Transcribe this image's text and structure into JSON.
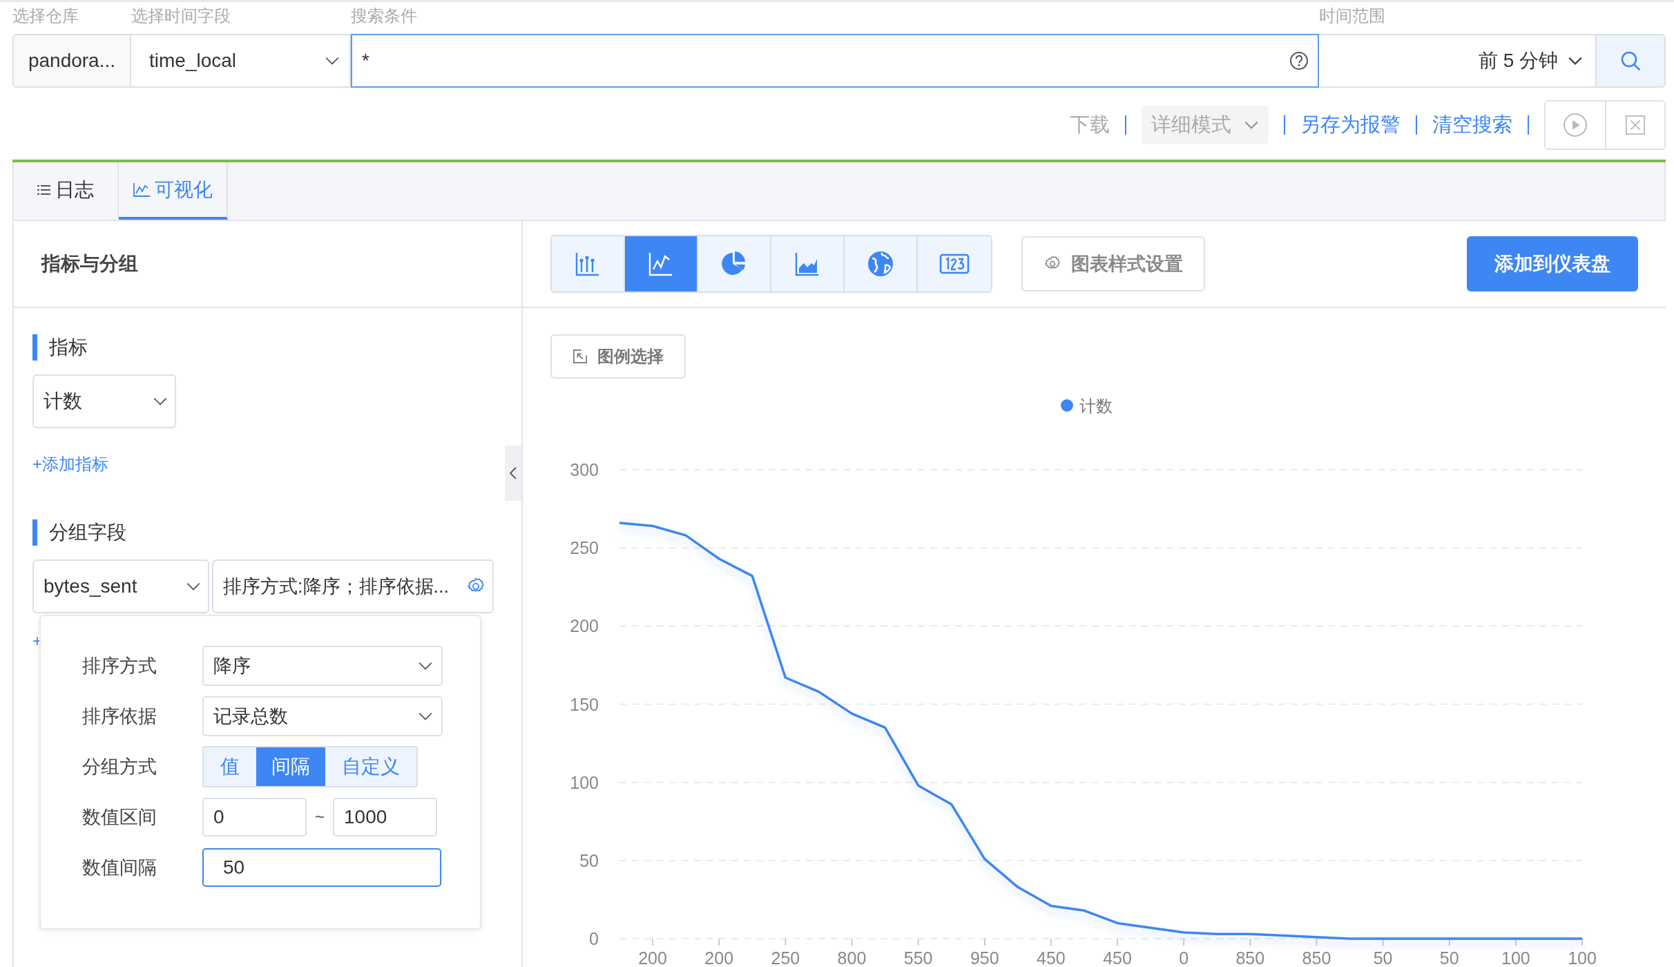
{
  "search_bar": {
    "repository": {
      "label": "选择仓库",
      "value": "pandora..."
    },
    "time_field": {
      "label": "选择时间字段",
      "value": "time_local"
    },
    "query": {
      "label": "搜索条件",
      "value": "*"
    },
    "time_range": {
      "label": "时间范围",
      "value": "前 5 分钟"
    }
  },
  "actions": [
    {
      "kind": "link",
      "label": "下载",
      "disabled": true
    },
    {
      "kind": "select",
      "label": "详细模式",
      "disabled": true
    },
    {
      "kind": "link",
      "label": "另存为报警",
      "disabled": false
    },
    {
      "kind": "link",
      "label": "清空搜索",
      "disabled": false
    }
  ],
  "tabs": [
    {
      "label": "日志",
      "selected": false
    },
    {
      "label": "可视化",
      "selected": true
    }
  ],
  "left_panel": {
    "title": "指标与分组",
    "metrics": {
      "heading": "指标",
      "value": "计数",
      "add_link": "+添加指标"
    },
    "grouping": {
      "heading": "分组字段",
      "field": "bytes_sent",
      "summary": "排序方式:降序；排序依据...",
      "add_link": "+"
    },
    "popover": [
      {
        "kind": "select",
        "label": "排序方式",
        "value": "降序"
      },
      {
        "kind": "select",
        "label": "排序依据",
        "value": "记录总数"
      },
      {
        "kind": "segmented",
        "label": "分组方式",
        "options": [
          {
            "label": "值",
            "selected": false
          },
          {
            "label": "间隔",
            "selected": true
          },
          {
            "label": "自定义",
            "selected": false
          }
        ]
      },
      {
        "kind": "range",
        "label": "数值区间",
        "from": "0",
        "separator": "~",
        "to": "1000"
      },
      {
        "kind": "input",
        "label": "数值间隔",
        "value": "50",
        "focused": true
      }
    ]
  },
  "chart_types": [
    {
      "kind": "bar",
      "selected": false
    },
    {
      "kind": "line",
      "selected": true
    },
    {
      "kind": "pie",
      "selected": false
    },
    {
      "kind": "area",
      "selected": false
    },
    {
      "kind": "map",
      "selected": false
    },
    {
      "kind": "number",
      "selected": false
    }
  ],
  "style_button": "图表样式设置",
  "add_button": "添加到仪表盘",
  "legend_button": "图例选择",
  "chart": {
    "chart_data": {
      "type": "line",
      "categories": [
        null,
        "200",
        null,
        "200",
        null,
        "250",
        null,
        "800",
        null,
        "550",
        null,
        "950",
        null,
        "450",
        null,
        "450",
        null,
        "0",
        null,
        "850",
        null,
        "850",
        null,
        "50",
        null,
        "50",
        null,
        "100",
        null,
        "100"
      ],
      "series": [
        {
          "name": "计数",
          "color": "#3d86f3",
          "values": [
            266,
            264,
            258,
            243,
            232,
            167,
            158,
            144,
            135,
            98,
            86,
            51,
            33,
            21,
            18,
            10,
            7,
            4,
            3,
            3,
            2,
            1,
            0,
            0,
            0,
            0,
            0,
            0,
            0,
            0
          ]
        }
      ],
      "ylim": [
        0,
        300
      ],
      "yticks": [
        0,
        50,
        100,
        150,
        200,
        250,
        300
      ],
      "grid": true
    }
  }
}
